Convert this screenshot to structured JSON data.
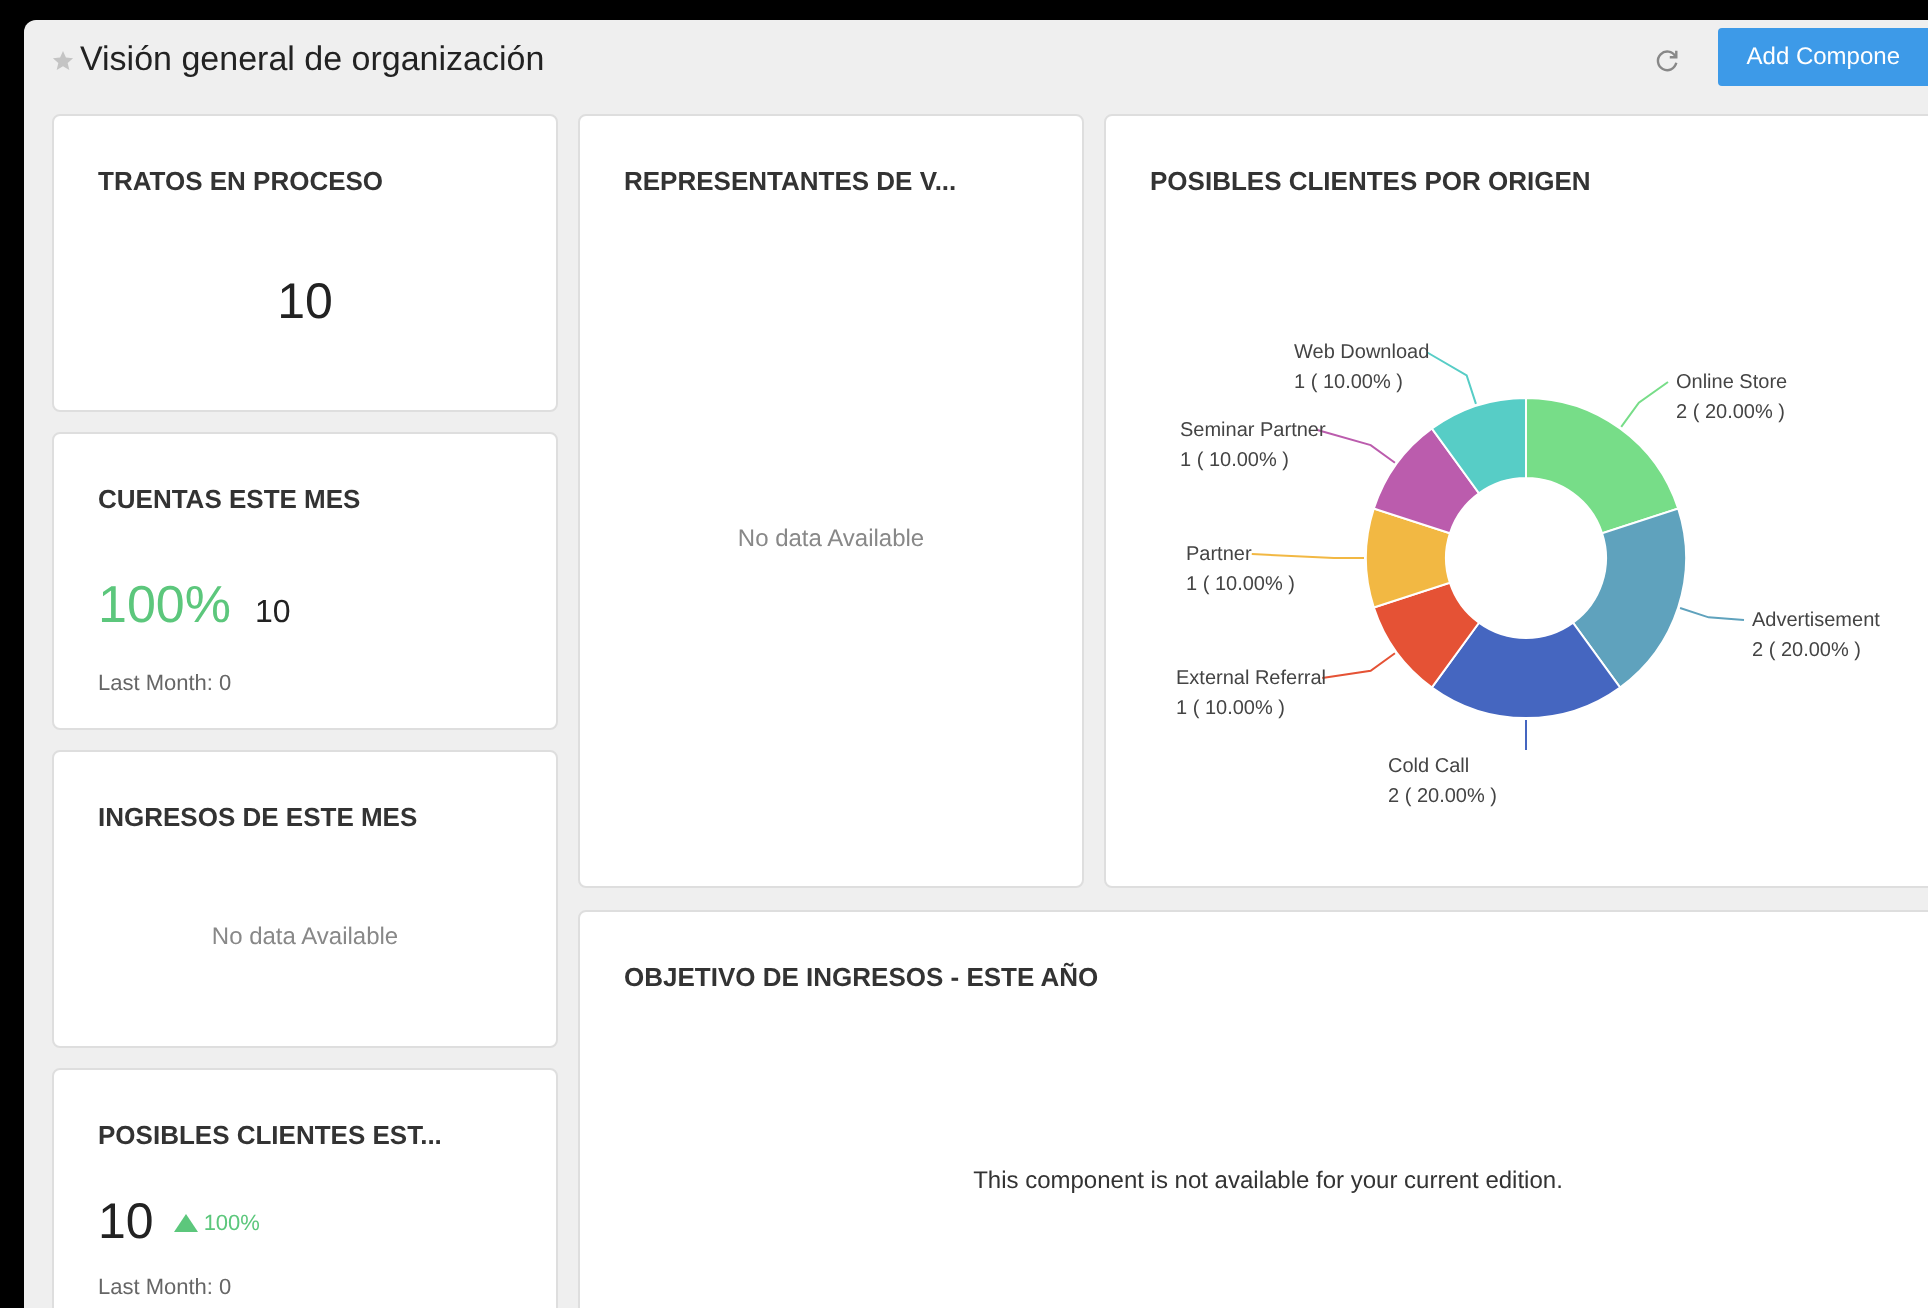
{
  "header": {
    "title": "Visión general de organización",
    "button": "Add Compone"
  },
  "left_cards": [
    {
      "kind": "count",
      "title": "TRATOS EN PROCESO",
      "value": "10"
    },
    {
      "kind": "percent",
      "title": "CUENTAS ESTE MES",
      "percent": "100%",
      "value": "10",
      "note": "Last Month: 0"
    },
    {
      "kind": "empty",
      "title": "INGRESOS DE ESTE MES",
      "message": "No data Available"
    },
    {
      "kind": "trend",
      "title": "POSIBLES CLIENTES EST...",
      "value": "10",
      "change": "100%",
      "note": "Last Month: 0"
    }
  ],
  "reps_card": {
    "title": "REPRESENTANTES DE V...",
    "message": "No data Available"
  },
  "leads_card": {
    "title": "POSIBLES CLIENTES POR ORIGEN",
    "chart_data": {
      "type": "donut",
      "categories": [
        "Online Store",
        "Advertisement",
        "Cold Call",
        "External Referral",
        "Partner",
        "Seminar Partner",
        "Web Download"
      ],
      "values": [
        2,
        2,
        2,
        1,
        1,
        1,
        1
      ],
      "colors": [
        "#77dd88",
        "#5fa2bd",
        "#4566c0",
        "#e55235",
        "#f2b843",
        "#bb5cad",
        "#57cdc6"
      ],
      "value_labels": [
        "2 ( 20.00% )",
        "2 ( 20.00% )",
        "2 ( 20.00% )",
        "1 ( 10.00% )",
        "1 ( 10.00% )",
        "1 ( 10.00% )",
        "1 ( 10.00% )"
      ]
    }
  },
  "goal_card": {
    "title": "OBJETIVO DE INGRESOS - ESTE AÑO",
    "message": "This component is not available for your current edition."
  }
}
